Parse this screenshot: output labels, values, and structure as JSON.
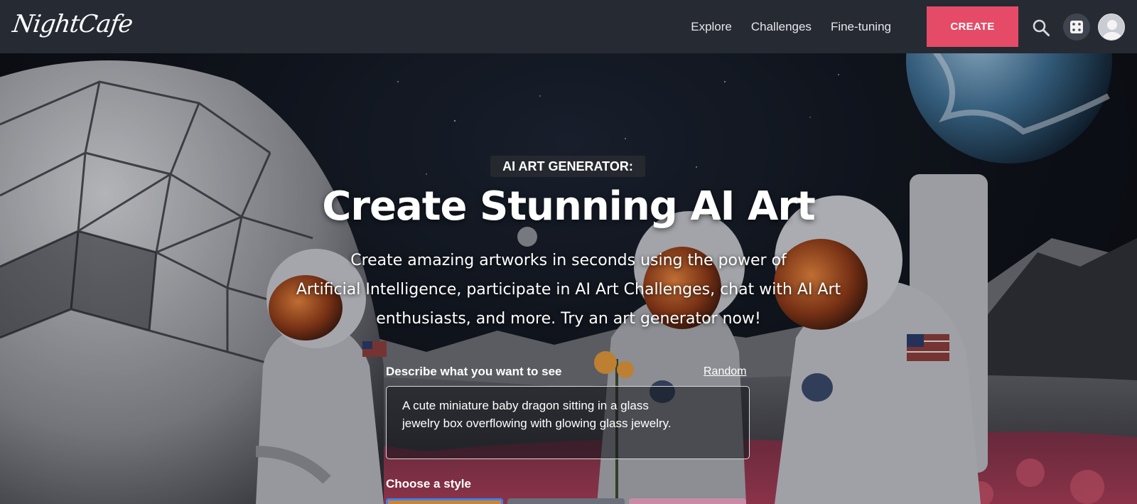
{
  "header": {
    "logo_text": "NightCafe",
    "nav": [
      {
        "label": "Explore"
      },
      {
        "label": "Challenges"
      },
      {
        "label": "Fine-tuning"
      }
    ],
    "create_label": "CREATE",
    "accent_color": "#e54b67"
  },
  "hero": {
    "badge": "AI ART GENERATOR:",
    "title": "Create Stunning AI Art",
    "subtitle_lines": [
      "Create amazing artworks in seconds using the power of",
      "Artificial Intelligence, participate in AI Art Challenges, chat with AI Art",
      "enthusiasts, and more. Try an art generator now!"
    ]
  },
  "prompt": {
    "label": "Describe what you want to see",
    "random_label": "Random",
    "value_lines": [
      "A cute miniature baby dragon sitting in a glass",
      "jewelry box overflowing with glowing glass jewelry."
    ]
  },
  "styles": {
    "label": "Choose a style",
    "thumbs": [
      {
        "color": "#c9863a",
        "selected": true
      },
      {
        "color": "#6b6f7a",
        "selected": false
      },
      {
        "color": "#c88ba6",
        "selected": false
      }
    ]
  }
}
